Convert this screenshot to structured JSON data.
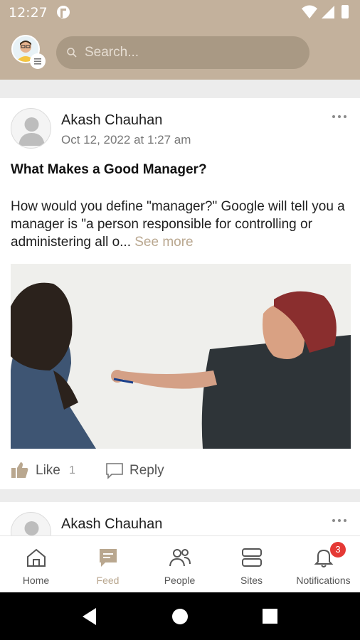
{
  "status_bar": {
    "time": "12:27",
    "icons": [
      "g-icon",
      "wifi-icon",
      "signal-icon",
      "battery-icon"
    ]
  },
  "header": {
    "search_placeholder": "Search..."
  },
  "posts": [
    {
      "author": "Akash Chauhan",
      "date": "Oct 12, 2022 at 1:27 am",
      "title": "What Makes a Good Manager?",
      "body": "How would you define \"manager?\" Google will tell you a manager is \"a person responsible for controlling or administering all o...",
      "see_more": "See more",
      "like_label": "Like",
      "like_count": "1",
      "reply_label": "Reply"
    },
    {
      "author": "Akash Chauhan"
    }
  ],
  "bottom_nav": [
    {
      "label": "Home",
      "icon": "home-icon"
    },
    {
      "label": "Feed",
      "icon": "feed-icon",
      "active": true
    },
    {
      "label": "People",
      "icon": "people-icon"
    },
    {
      "label": "Sites",
      "icon": "sites-icon"
    },
    {
      "label": "Notifications",
      "icon": "bell-icon",
      "badge": "3"
    }
  ],
  "colors": {
    "brand": "#c3b19c",
    "accent": "#b9a78f",
    "badge": "#e53935"
  }
}
